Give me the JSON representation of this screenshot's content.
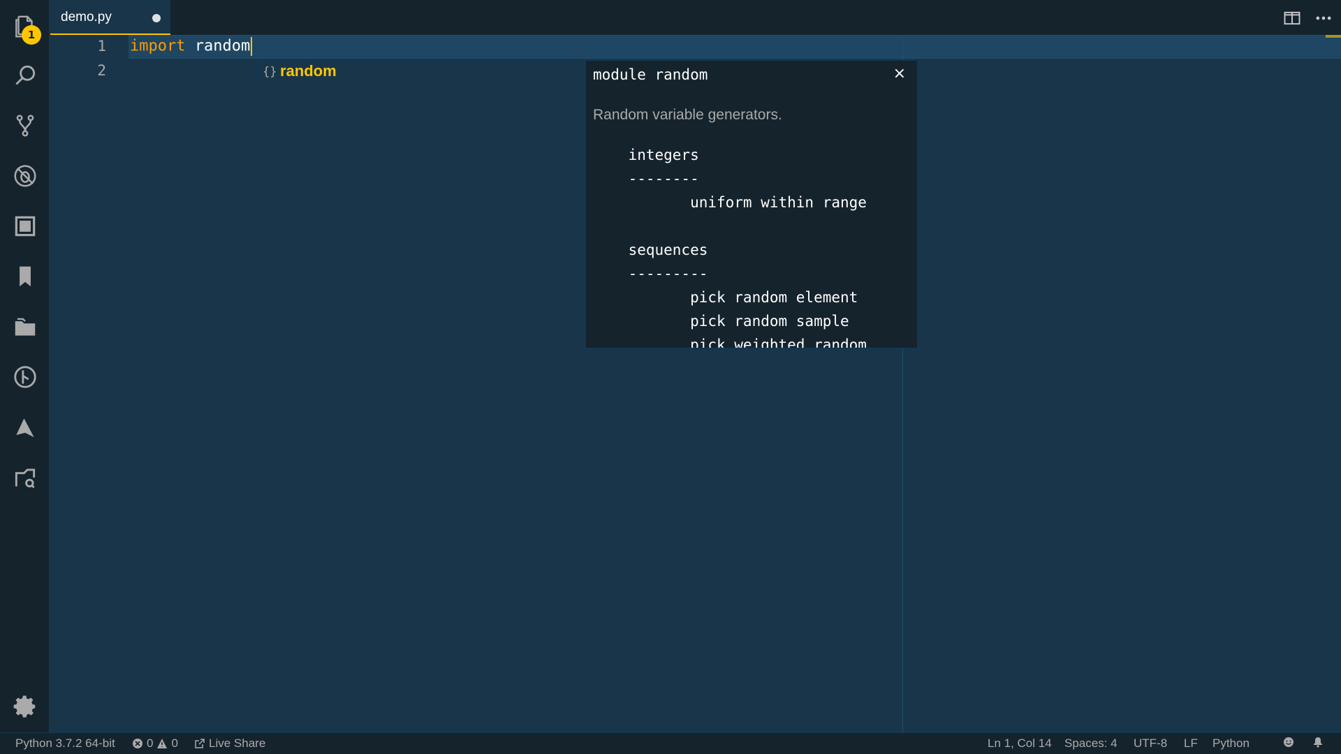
{
  "activity_bar": {
    "explorer_badge": "1"
  },
  "tabs": [
    {
      "label": "demo.py",
      "dirty": true
    }
  ],
  "editor": {
    "line_numbers": [
      "1",
      "2"
    ],
    "lines": [
      {
        "keyword": "import",
        "space": " ",
        "identifier": "random"
      },
      {
        "keyword": "",
        "space": "",
        "identifier": ""
      }
    ]
  },
  "suggest": {
    "icon": "{}",
    "label": "random"
  },
  "docs": {
    "signature": "module random",
    "summary": "Random variable generators.",
    "body": "    integers\n    --------\n           uniform within range\n\n    sequences\n    ---------\n           pick random element\n           pick random sample\n           pick weighted random",
    "close": "×"
  },
  "status_bar": {
    "interpreter": "Python 3.7.2 64-bit",
    "errors": "0",
    "warnings": "0",
    "live_share": "Live Share",
    "cursor_pos": "Ln 1, Col 14",
    "indent": "Spaces: 4",
    "encoding": "UTF-8",
    "eol": "LF",
    "language": "Python"
  },
  "colors": {
    "background": "#193549",
    "sidebar": "#15232d",
    "accent": "#ffc600",
    "keyword": "#ff9d00"
  }
}
